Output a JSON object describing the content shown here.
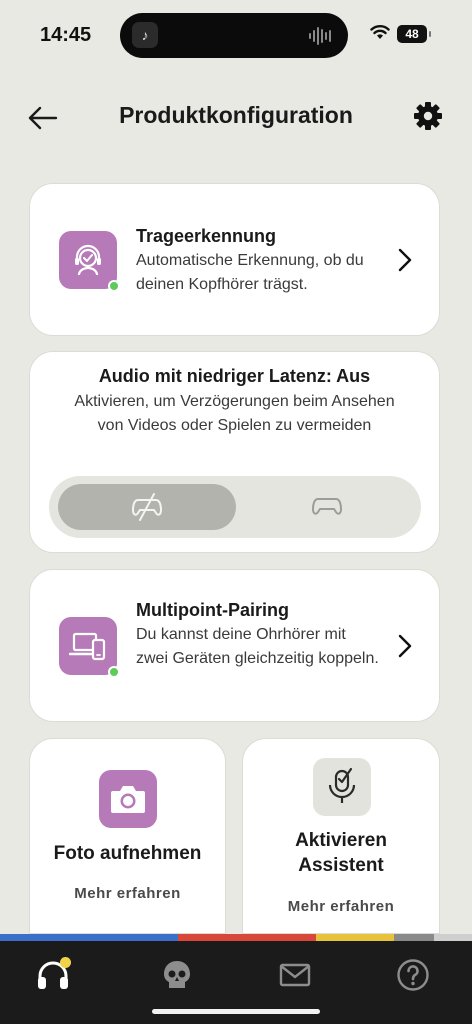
{
  "status_bar": {
    "time": "14:45",
    "battery": "48"
  },
  "header": {
    "title": "Produktkonfiguration",
    "back_icon": "arrow-left-icon",
    "settings_icon": "gear-icon"
  },
  "cards": {
    "wear_detection": {
      "title": "Trageerkennung",
      "description": "Automatische Erkennung, ob du deinen Kopfhörer trägst.",
      "icon": "headset-person-icon",
      "status": "active"
    },
    "low_latency": {
      "title": "Audio mit niedriger Latenz: Aus",
      "description": "Aktivieren, um Verzögerungen beim Ansehen von Videos oder Spielen zu vermeiden",
      "options": [
        "off",
        "on"
      ],
      "selected": "off"
    },
    "multipoint": {
      "title": "Multipoint-Pairing",
      "description": "Du kannst deine Ohrhörer mit zwei Geräten gleichzeitig koppeln.",
      "icon": "laptop-phone-icon",
      "status": "active"
    },
    "photo": {
      "title": "Foto aufnehmen",
      "link": "Mehr erfahren",
      "icon": "camera-icon"
    },
    "assistant": {
      "title": "Aktivieren Assistent",
      "link": "Mehr erfahren",
      "icon": "microphone-check-icon"
    }
  },
  "colors": {
    "accent_purple": "#b67ab8",
    "status_green": "#5ecb5a",
    "stripe": [
      "#3b6fc9",
      "#d9473a",
      "#e8c23a",
      "#8a8a8a"
    ],
    "tabbar": "#1b1b1b"
  },
  "tabbar": {
    "tabs": [
      {
        "icon": "headphones-icon",
        "badge": true
      },
      {
        "icon": "skull-logo-icon"
      },
      {
        "icon": "mail-icon"
      },
      {
        "icon": "help-icon"
      }
    ]
  }
}
